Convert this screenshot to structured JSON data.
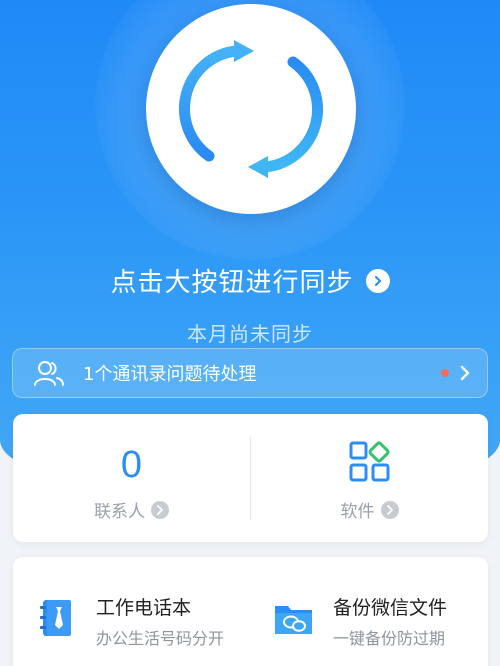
{
  "hero": {
    "cta_label": "点击大按钮进行同步",
    "status_text": "本月尚未同步",
    "accent_color": "#2a92f7",
    "icons": {
      "sync": "sync-arrows-icon",
      "cta": "chevron-right-icon"
    }
  },
  "notice": {
    "text": "1个通讯录问题待处理",
    "dot_color": "#f26b5e",
    "icons": {
      "left": "contacts-people-icon",
      "right": "chevron-right-icon"
    }
  },
  "stats": {
    "contacts": {
      "value": "0",
      "label": "联系人"
    },
    "apps": {
      "label": "软件",
      "icon": "apps-grid-icon"
    }
  },
  "features": [
    {
      "title": "工作电话本",
      "subtitle": "办公生活号码分开",
      "icon": "work-phonebook-icon"
    },
    {
      "title": "备份微信文件",
      "subtitle": "一键备份防过期",
      "icon": "wechat-backup-icon"
    }
  ]
}
